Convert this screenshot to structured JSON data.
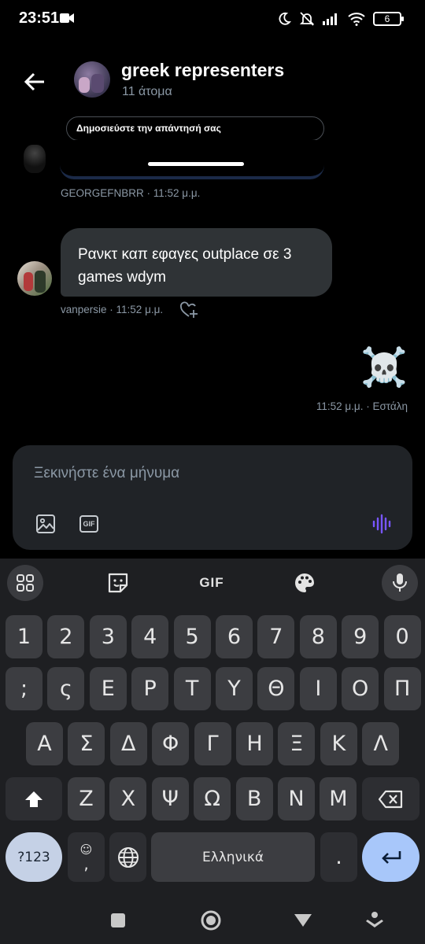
{
  "status": {
    "time": "23:51",
    "battery": "6"
  },
  "header": {
    "title": "greek representers",
    "subtitle": "11 άτομα",
    "back_icon": "arrow-left-icon"
  },
  "reply_banner": "Δημοσιεύστε την απάντησή σας",
  "messages": [
    {
      "meta": "GEORGEFNBRR · 11:52 μ.μ."
    },
    {
      "text": "Ρανκτ καπ εφαγες outplace σε 3 games wdym",
      "meta": "vanpersie · 11:52 μ.μ."
    },
    {
      "text": "☠️",
      "meta": "11:52 μ.μ. · Εστάλη"
    }
  ],
  "composer": {
    "placeholder": "Ξεκινήστε ένα μήνυμα",
    "gif_label": "GIF",
    "icons": [
      "image-icon",
      "gif-icon",
      "voice-wave-icon"
    ],
    "accent": "#1d9bf0",
    "voice_color": "#7856ff"
  },
  "keyboard": {
    "toolbar_gif": "GIF",
    "row1": [
      "1",
      "2",
      "3",
      "4",
      "5",
      "6",
      "7",
      "8",
      "9",
      "0"
    ],
    "row2": [
      ";",
      "ς",
      "Ε",
      "Ρ",
      "Τ",
      "Υ",
      "Θ",
      "Ι",
      "Ο",
      "Π"
    ],
    "row3": [
      "Α",
      "Σ",
      "Δ",
      "Φ",
      "Γ",
      "Η",
      "Ξ",
      "Κ",
      "Λ"
    ],
    "row4": [
      "Ζ",
      "Χ",
      "Ψ",
      "Ω",
      "Β",
      "Ν",
      "Μ"
    ],
    "symbols_key": "?123",
    "comma_key": ",",
    "space_label": "Ελληνικά",
    "period_key": "."
  }
}
